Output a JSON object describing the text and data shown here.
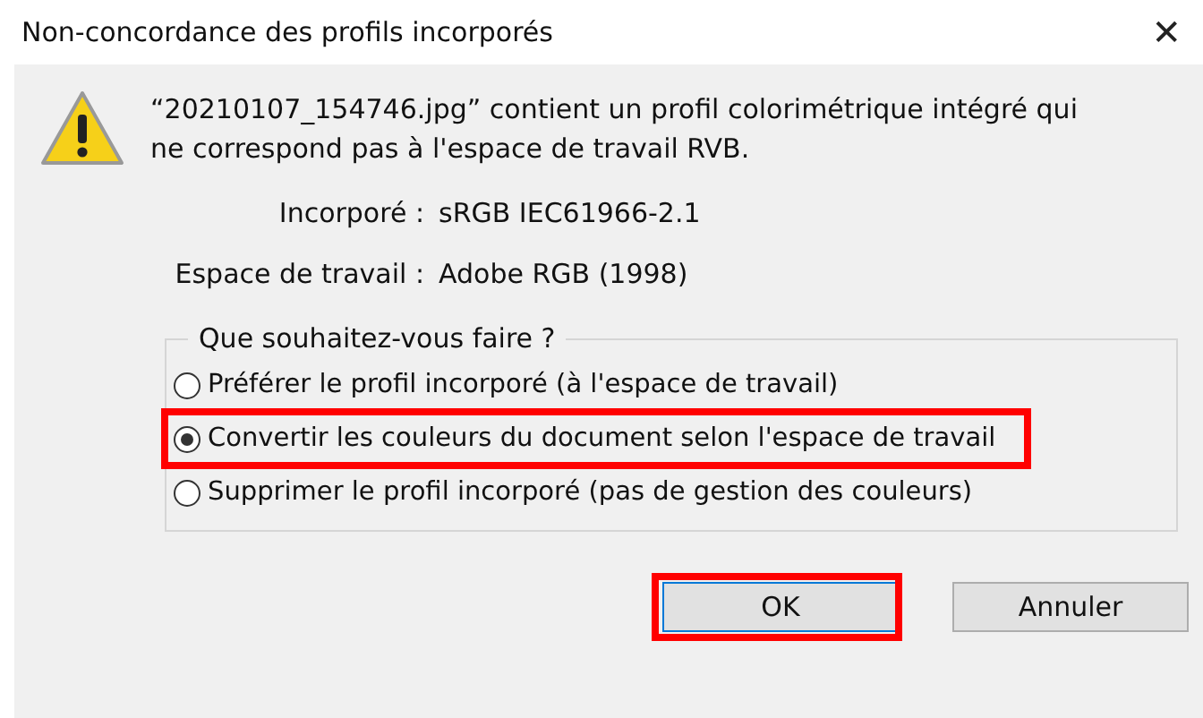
{
  "window": {
    "title": "Non-concordance des profils incorporés",
    "close": "✕"
  },
  "message": "“20210107_154746.jpg” contient un profil colorimétrique intégré qui ne correspond pas à l'espace de travail RVB.",
  "profiles": [
    {
      "label": "Incorporé :",
      "value": "sRGB IEC61966-2.1"
    },
    {
      "label": "Espace de travail :",
      "value": "Adobe RGB (1998)"
    }
  ],
  "group": {
    "title": "Que souhaitez-vous faire ?",
    "options": [
      {
        "label": "Préférer le profil incorporé (à l'espace de travail)",
        "selected": false,
        "highlighted": false
      },
      {
        "label": "Convertir les couleurs du document selon l'espace de travail",
        "selected": true,
        "highlighted": true
      },
      {
        "label": "Supprimer le profil incorporé (pas de gestion des couleurs)",
        "selected": false,
        "highlighted": false
      }
    ]
  },
  "buttons": [
    {
      "label": "OK",
      "highlighted": true
    },
    {
      "label": "Annuler",
      "highlighted": false
    }
  ]
}
